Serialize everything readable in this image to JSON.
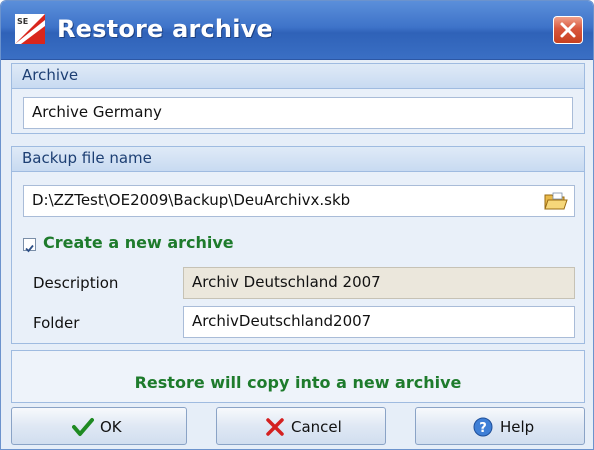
{
  "window": {
    "title": "Restore archive"
  },
  "archive_section": {
    "header": "Archive",
    "value": "Archive Germany"
  },
  "backup_section": {
    "header": "Backup file name",
    "file_path": "D:\\ZZTest\\OE2009\\Backup\\DeuArchivx.skb",
    "create_new": {
      "label": "Create a new archive",
      "checked": true
    },
    "description": {
      "label": "Description",
      "value": "Archiv Deutschland 2007"
    },
    "folder": {
      "label": "Folder",
      "value": "ArchivDeutschland2007"
    }
  },
  "info": {
    "message": "Restore will copy into a new archive"
  },
  "buttons": {
    "ok": "OK",
    "cancel": "Cancel",
    "help": "Help"
  },
  "colors": {
    "title_bar": "#3e73c9",
    "accent_text": "#1e7b2c",
    "close": "#d9573d"
  },
  "icons": {
    "app": "app-logo-icon",
    "close": "close-icon",
    "browse": "open-folder-icon",
    "check": "check-mark-icon",
    "ok": "green-check-icon",
    "cancel": "red-x-icon",
    "help": "help-icon"
  }
}
